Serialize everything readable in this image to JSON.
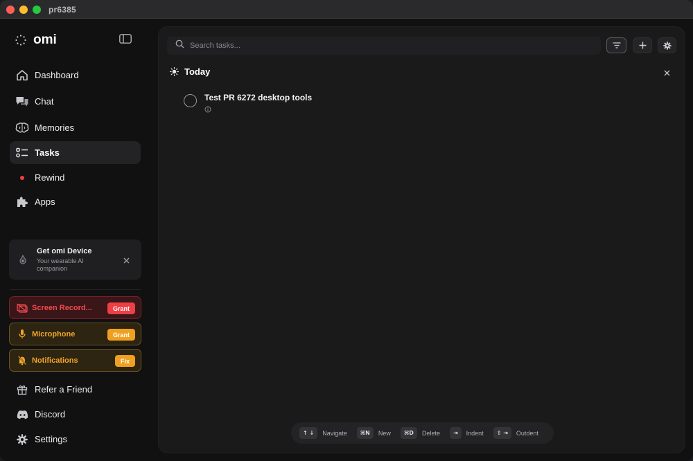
{
  "window": {
    "title": "pr6385"
  },
  "brand": {
    "name": "omi"
  },
  "nav": [
    {
      "label": "Dashboard",
      "icon": "home-icon"
    },
    {
      "label": "Chat",
      "icon": "chat-bubbles-icon"
    },
    {
      "label": "Memories",
      "icon": "brain-icon"
    },
    {
      "label": "Tasks",
      "icon": "checklist-icon",
      "active": true
    },
    {
      "label": "Rewind",
      "icon": "record-dot-icon"
    },
    {
      "label": "Apps",
      "icon": "puzzle-icon"
    }
  ],
  "device_card": {
    "title": "Get omi Device",
    "subtitle": "Your wearable AI companion"
  },
  "permissions": {
    "screen": {
      "label": "Screen Record...",
      "button": "Grant"
    },
    "mic": {
      "label": "Microphone",
      "button": "Grant"
    },
    "notifications": {
      "label": "Notifications",
      "button": "Fix"
    }
  },
  "footer_nav": [
    {
      "label": "Refer a Friend",
      "icon": "gift-icon"
    },
    {
      "label": "Discord",
      "icon": "discord-icon"
    },
    {
      "label": "Settings",
      "icon": "gear-icon"
    }
  ],
  "search": {
    "placeholder": "Search tasks..."
  },
  "section": {
    "title": "Today"
  },
  "tasks": [
    {
      "title": "Test PR 6272 desktop tools"
    }
  ],
  "shortcuts": [
    {
      "key": "↑ ↓",
      "label": "Navigate"
    },
    {
      "key": "⌘N",
      "label": "New"
    },
    {
      "key": "⌘D",
      "label": "Delete"
    },
    {
      "key": "⇥",
      "label": "Indent"
    },
    {
      "key": "⇧ ⇥",
      "label": "Outdent"
    }
  ],
  "colors": {
    "danger": "#ee3f45",
    "warning": "#f0a020",
    "background": "#111112",
    "panel": "#1a1a1b"
  }
}
